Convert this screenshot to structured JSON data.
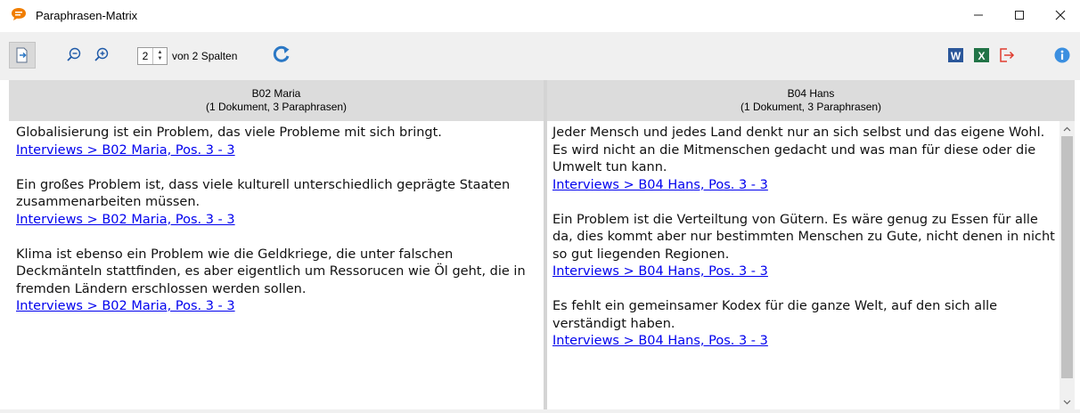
{
  "window": {
    "title": "Paraphrasen-Matrix",
    "minimize_label": "—",
    "maximize_label": "☐",
    "close_label": "✕"
  },
  "toolbar": {
    "columns_value": "2",
    "columns_label": "von 2 Spalten",
    "icons": [
      "export-icon",
      "zoom-out-icon",
      "zoom-in-icon",
      "refresh-icon",
      "word-export-icon",
      "excel-export-icon",
      "exit-icon",
      "info-icon"
    ]
  },
  "colors": {
    "accent_orange": "#f07d00",
    "refresh_blue": "#2b78c5",
    "word_blue": "#2b579a",
    "excel_green": "#217346",
    "exit_red": "#e03c2f",
    "info_blue": "#3b8fe0",
    "link": "#0000ee"
  },
  "columns": [
    {
      "header_name": "B02 Maria",
      "header_count": "(1 Dokument, 3 Paraphrasen)",
      "entries": [
        {
          "text": "Globalisierung ist ein Problem, das viele Probleme mit sich bringt.",
          "link": "Interviews > B02 Maria, Pos. 3 - 3"
        },
        {
          "text": "Ein großes Problem ist, dass viele kulturell unterschiedlich geprägte Staaten zusammenarbeiten müssen.",
          "link": "Interviews > B02 Maria, Pos. 3 - 3"
        },
        {
          "text": "Klima ist ebenso ein Problem wie die Geldkriege, die unter falschen Deckmänteln stattfinden, es aber eigentlich um Ressorucen wie Öl geht, die in fremden Ländern erschlossen werden sollen.",
          "link": "Interviews > B02 Maria, Pos. 3 - 3"
        }
      ]
    },
    {
      "header_name": "B04 Hans",
      "header_count": "(1 Dokument, 3 Paraphrasen)",
      "entries": [
        {
          "text": "Jeder Mensch und jedes Land denkt nur an sich selbst und das eigene Wohl. Es wird nicht an die Mitmenschen gedacht und was man für diese oder die Umwelt tun kann.",
          "link": "Interviews > B04 Hans, Pos. 3 - 3"
        },
        {
          "text": "Ein Problem ist die Verteiltung von Gütern. Es wäre genug zu Essen für alle da, dies kommt aber nur bestimmten Menschen zu Gute, nicht denen in nicht so gut liegenden Regionen.",
          "link": "Interviews > B04 Hans, Pos. 3 - 3"
        },
        {
          "text": "Es fehlt ein gemeinsamer Kodex für die ganze Welt, auf den sich alle verständigt haben.",
          "link": "Interviews > B04 Hans, Pos. 3 - 3"
        }
      ]
    }
  ]
}
